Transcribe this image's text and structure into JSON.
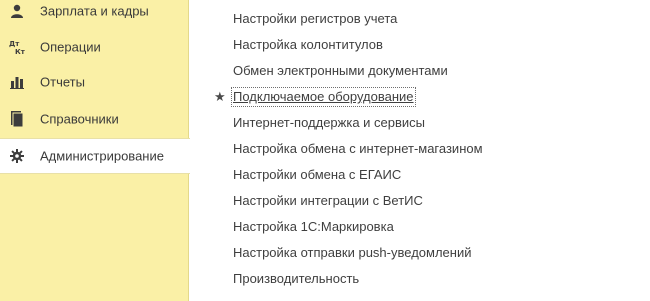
{
  "sidebar": {
    "items": [
      {
        "label": "Зарплата и кадры",
        "icon": "person-icon"
      },
      {
        "label": "Операции",
        "icon": "debit-credit-icon"
      },
      {
        "label": "Отчеты",
        "icon": "bar-chart-icon"
      },
      {
        "label": "Справочники",
        "icon": "book-icon"
      },
      {
        "label": "Администрирование",
        "icon": "gear-icon",
        "active": true
      }
    ]
  },
  "main": {
    "links": [
      "Настройки регистров учета",
      "Настройка колонтитулов",
      "Обмен электронными документами",
      "Подключаемое оборудование",
      "Интернет-поддержка и сервисы",
      "Настройка обмена с интернет-магазином",
      "Настройки обмена с ЕГАИС",
      "Настройки интеграции с ВетИС",
      "Настройка 1С:Маркировка",
      "Настройка отправки push-уведомлений",
      "Производительность"
    ],
    "favorite_index": 3,
    "favorite_icon": "star-icon"
  },
  "colors": {
    "sidebar_bg": "#faf0a6",
    "text": "#3f3f3f",
    "active_bg": "#ffffff"
  }
}
